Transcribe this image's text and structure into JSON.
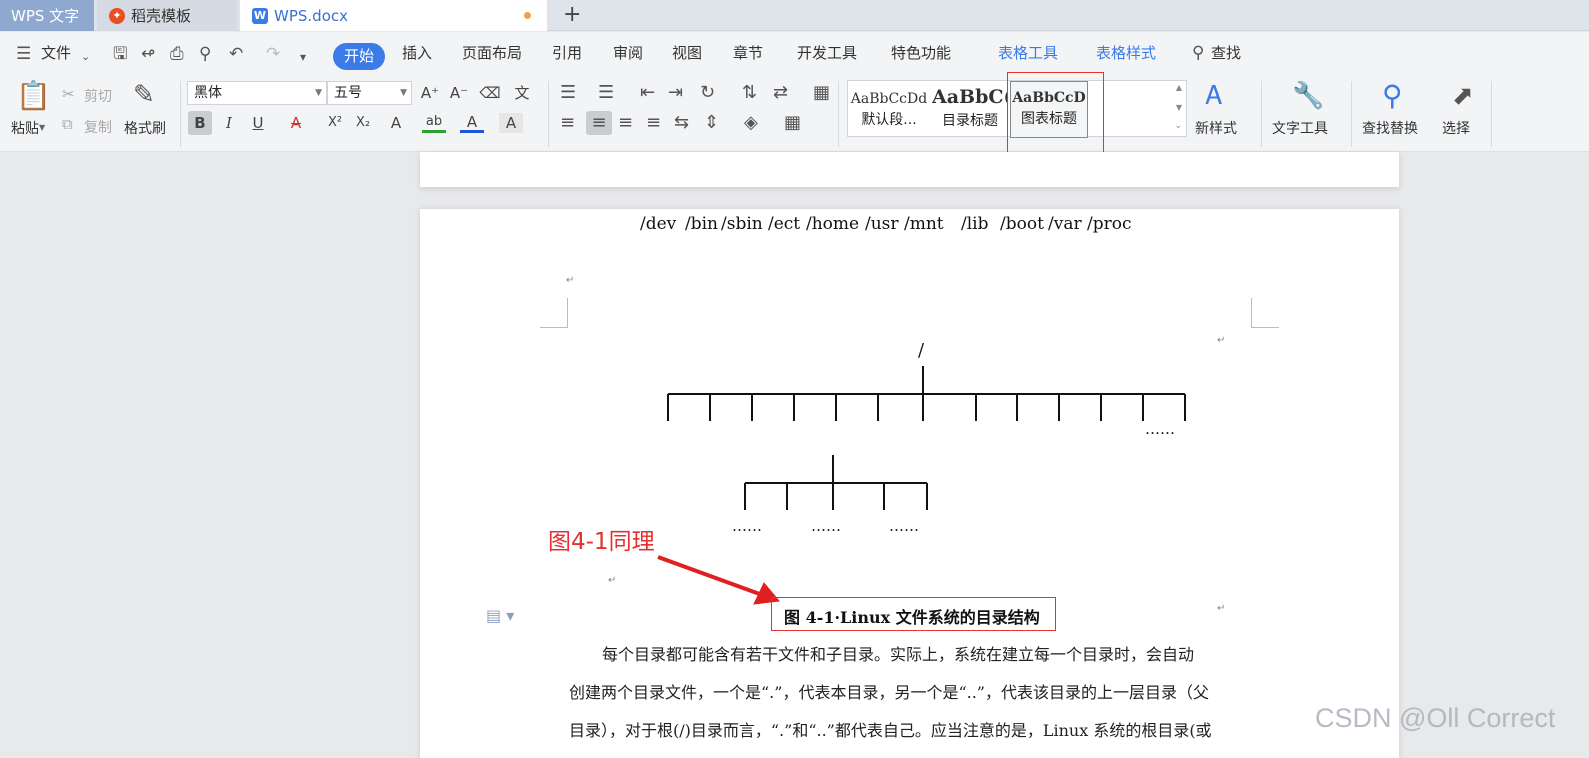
{
  "tabs": {
    "wps": "WPS 文字",
    "daoke": "稻壳模板",
    "doc": "WPS.docx",
    "new_tab": "+"
  },
  "menu": {
    "file": "文件",
    "start": "开始",
    "insert": "插入",
    "layout": "页面布局",
    "reference": "引用",
    "review": "审阅",
    "view": "视图",
    "chapter": "章节",
    "dev": "开发工具",
    "special": "特色功能",
    "table_tools": "表格工具",
    "table_style": "表格样式",
    "find": "查找"
  },
  "ribbon": {
    "paste": "粘贴",
    "cut": "剪切",
    "copy": "复制",
    "format_painter": "格式刷",
    "font_name": "黑体",
    "font_size": "五号",
    "styles": [
      {
        "preview": "AaBbCcDd",
        "name": "默认段..."
      },
      {
        "preview": "AaBbC(",
        "name": "目录标题"
      },
      {
        "preview": "AaBbCcD",
        "name": "图表标题"
      }
    ],
    "new_style": "新样式",
    "text_tools": "文字工具",
    "find_replace": "查找替换",
    "select": "选择",
    "font_btns": {
      "bold": "B",
      "italic": "I",
      "underline": "U",
      "strike": "A",
      "sup": "X²",
      "sub": "X₂",
      "effect": "A",
      "highlight": "ab",
      "color": "A",
      "shade": "A"
    }
  },
  "document": {
    "root": "/",
    "dirs": [
      "/dev",
      "/bin",
      "/sbin",
      "/ect",
      "/home",
      "/usr",
      "/mnt",
      "/lib",
      "/boot",
      "/var",
      "/proc",
      "……"
    ],
    "sub_dirs": [
      "……",
      "……",
      "……"
    ],
    "annotation": "图4-1同理",
    "caption": "图 4-1·Linux 文件系统的目录结构",
    "paragraph_lines": [
      "每个目录都可能含有若干文件和子目录。实际上，系统在建立每一个目录时，会自动",
      "创建两个目录文件，一个是“.”，代表本目录，另一个是“..”，代表该目录的上一层目录（父",
      "目录），对于根(/)目录而言，“.”和“..”都代表自己。应当注意的是，Linux 系统的根目录(或"
    ]
  },
  "watermark": "CSDN @Oll Correct",
  "colors": {
    "accent": "#3b7be8",
    "annotation": "#e53030"
  }
}
